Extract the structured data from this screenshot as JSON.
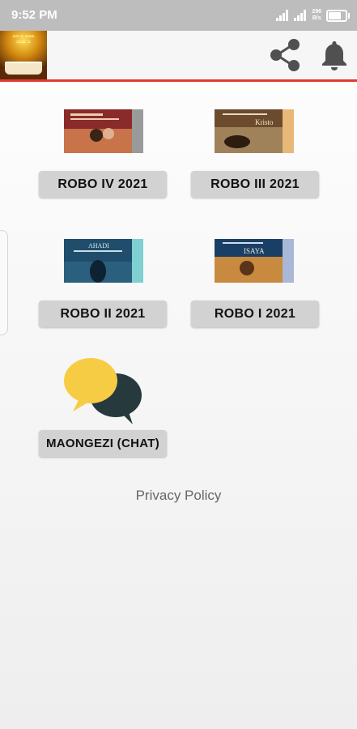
{
  "status_bar": {
    "time": "9:52 PM",
    "net_speed_value": "296",
    "net_speed_unit": "B/s",
    "battery_level": 0.85
  },
  "app_bar": {
    "share_icon": "share-icon",
    "bell_icon": "bell-icon"
  },
  "quarters": [
    {
      "label": "ROBO IV 2021",
      "cover_colors": [
        "#8b2a2a",
        "#c8734a",
        "#9a9a9a"
      ]
    },
    {
      "label": "ROBO III 2021",
      "cover_colors": [
        "#6b4a2e",
        "#a0825a",
        "#e8b878"
      ],
      "cover_title": "Kristo"
    },
    {
      "label": "ROBO II 2021",
      "cover_colors": [
        "#1f4d6b",
        "#2b5f7e",
        "#7fd0d0"
      ],
      "cover_title": "AHADI"
    },
    {
      "label": "ROBO I 2021",
      "cover_colors": [
        "#1a3f66",
        "#c88a3e",
        "#a9b8d6"
      ],
      "cover_title": "ISAYA"
    }
  ],
  "chat": {
    "label": "MAONGEZI (CHAT)",
    "bubble_colors": [
      "#f7cc45",
      "#26393d"
    ]
  },
  "privacy_policy": "Privacy Policy",
  "colors": {
    "status_bar": "#bdbdbd",
    "accent_line": "#e53935",
    "button_bg": "#d2d2d2"
  }
}
